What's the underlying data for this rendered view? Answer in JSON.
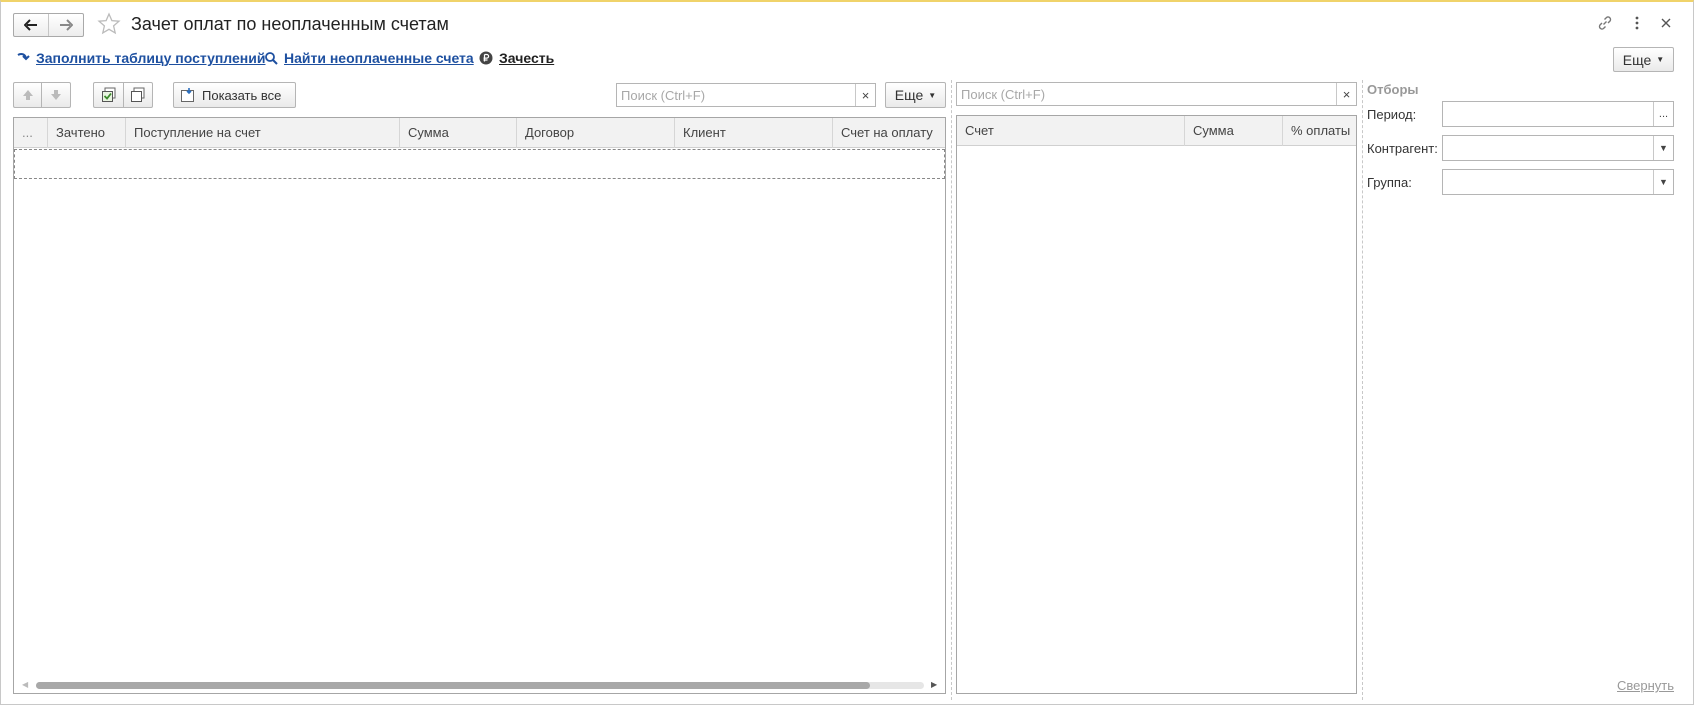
{
  "window": {
    "title": "Зачет оплат по неоплаченным счетам"
  },
  "commands": {
    "fill_receipts": "Заполнить таблицу поступлений",
    "find_unpaid": "Найти неоплаченные счета",
    "offset": "Зачесть",
    "more": "Еще"
  },
  "left_panel": {
    "show_all": "Показать все",
    "search_placeholder": "Поиск (Ctrl+F)",
    "search_value": "",
    "clear": "×",
    "more": "Еще",
    "columns": [
      "...",
      "Зачтено",
      "Поступление на счет",
      "Сумма",
      "Договор",
      "Клиент",
      "Счет на оплату"
    ],
    "rows": []
  },
  "right_panel": {
    "search_placeholder": "Поиск (Ctrl+F)",
    "search_value": "",
    "clear": "×",
    "columns": [
      "Счет",
      "Сумма",
      "% оплаты"
    ],
    "rows": []
  },
  "filters": {
    "title": "Отборы",
    "period_label": "Период:",
    "period_value": "",
    "period_button": "...",
    "counterparty_label": "Контрагент:",
    "counterparty_value": "",
    "group_label": "Группа:",
    "group_value": "",
    "collapse": "Свернуть"
  },
  "icons": {
    "back": "arrow-left-icon",
    "forward": "arrow-right-icon",
    "favorite": "star-icon",
    "link": "link-icon",
    "menu": "more-vertical-icon",
    "close": "close-icon",
    "fill": "fill-arrow-icon",
    "search": "search-icon",
    "ruble": "ruble-icon",
    "up": "arrow-up-icon",
    "down": "arrow-down-icon",
    "check_all": "check-all-icon",
    "uncheck_all": "uncheck-all-icon",
    "show_all": "show-all-icon"
  },
  "colors": {
    "link": "#1e50a0",
    "accent_border": "#f0d36a",
    "header_bg": "#f2f2f2"
  }
}
